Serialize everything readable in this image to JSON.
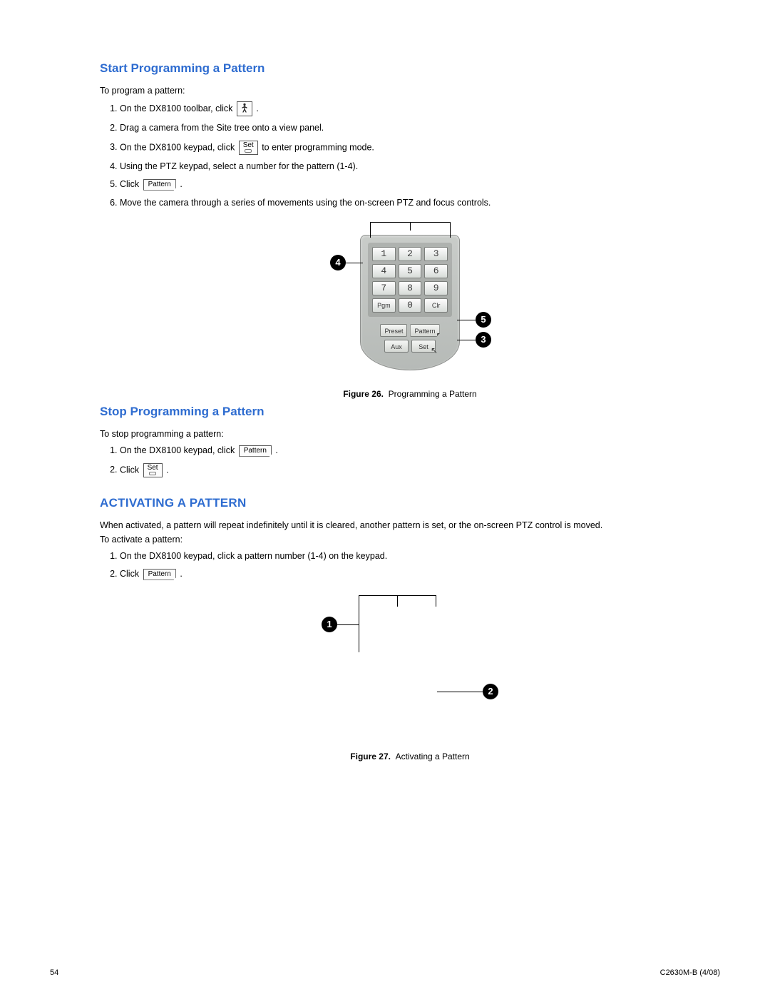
{
  "section1": {
    "heading": "Start Programming a Pattern",
    "intro": "To program a pattern:",
    "steps": {
      "s1a": "On the DX8100 toolbar, click",
      "s1b": ".",
      "s2": "Drag a camera from the Site tree onto a view panel.",
      "s3a": "On the DX8100 keypad, click",
      "s3b": "to enter programming mode.",
      "s4": "Using the PTZ keypad, select a number for the pattern (1-4).",
      "s5a": "Click",
      "s5b": ".",
      "s6": "Move the camera through a series of movements using the on-screen PTZ and focus controls."
    }
  },
  "keypad": {
    "keys": [
      "1",
      "2",
      "3",
      "4",
      "5",
      "6",
      "7",
      "8",
      "9",
      "Pgm",
      "0",
      "Clr"
    ],
    "sec": [
      "Preset",
      "Pattern",
      "Aux",
      "Set"
    ]
  },
  "figure26": {
    "label": "Figure 26.",
    "text": "Programming a Pattern"
  },
  "section2": {
    "heading": "Stop Programming a Pattern",
    "intro": "To stop programming a pattern:",
    "s1a": "On the DX8100 keypad, click",
    "s1b": ".",
    "s2a": "Click",
    "s2b": "."
  },
  "section3": {
    "heading": "ACTIVATING A PATTERN",
    "intro": "When activated, a pattern will repeat indefinitely until it is cleared, another pattern is set, or the on-screen PTZ control is moved.",
    "intro2": "To activate a pattern:",
    "s1": "On the DX8100 keypad, click a pattern number (1-4) on the keypad.",
    "s2a": "Click",
    "s2b": "."
  },
  "figure27": {
    "label": "Figure 27.",
    "text": "Activating a Pattern"
  },
  "icons": {
    "set": "Set",
    "pattern": "Pattern"
  },
  "callouts": {
    "c1": "1",
    "c2": "2",
    "c3": "3",
    "c4": "4",
    "c5": "5"
  },
  "footer": {
    "page": "54",
    "doc": "C2630M-B (4/08)"
  }
}
